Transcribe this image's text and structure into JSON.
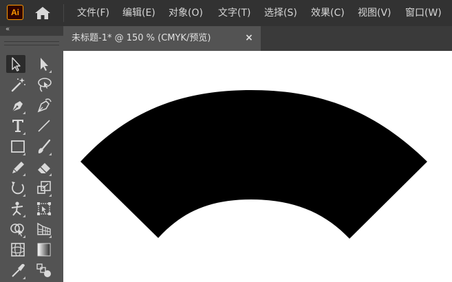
{
  "app": {
    "logo_text": "Ai"
  },
  "menu": {
    "items": [
      {
        "label": "文件(F)"
      },
      {
        "label": "编辑(E)"
      },
      {
        "label": "对象(O)"
      },
      {
        "label": "文字(T)"
      },
      {
        "label": "选择(S)"
      },
      {
        "label": "效果(C)"
      },
      {
        "label": "视图(V)"
      },
      {
        "label": "窗口(W)"
      }
    ]
  },
  "document": {
    "tab_title": "未标题-1* @ 150 % (CMYK/预览)",
    "close_glyph": "×"
  },
  "panel": {
    "collapse_glyph": "«"
  },
  "tools": [
    {
      "name": "selection-tool-icon",
      "selected": true
    },
    {
      "name": "direct-selection-tool-icon"
    },
    {
      "name": "magic-wand-tool-icon"
    },
    {
      "name": "lasso-tool-icon"
    },
    {
      "name": "pen-tool-icon"
    },
    {
      "name": "curvature-tool-icon"
    },
    {
      "name": "type-tool-icon"
    },
    {
      "name": "line-segment-tool-icon"
    },
    {
      "name": "rectangle-tool-icon"
    },
    {
      "name": "paintbrush-tool-icon"
    },
    {
      "name": "pencil-tool-icon"
    },
    {
      "name": "eraser-tool-icon"
    },
    {
      "name": "rotate-tool-icon"
    },
    {
      "name": "scale-tool-icon"
    },
    {
      "name": "puppet-warp-tool-icon"
    },
    {
      "name": "free-transform-tool-icon"
    },
    {
      "name": "shape-builder-tool-icon"
    },
    {
      "name": "perspective-grid-tool-icon"
    },
    {
      "name": "mesh-tool-icon"
    },
    {
      "name": "gradient-tool-icon"
    },
    {
      "name": "eyedropper-tool-icon"
    },
    {
      "name": "blend-tool-icon"
    }
  ],
  "colors": {
    "menubar": "#323232",
    "panel": "#535353",
    "canvas": "#ffffff",
    "shape_fill": "#000000",
    "icon": "#d9d9d9",
    "logo_accent": "#ff9a00"
  }
}
